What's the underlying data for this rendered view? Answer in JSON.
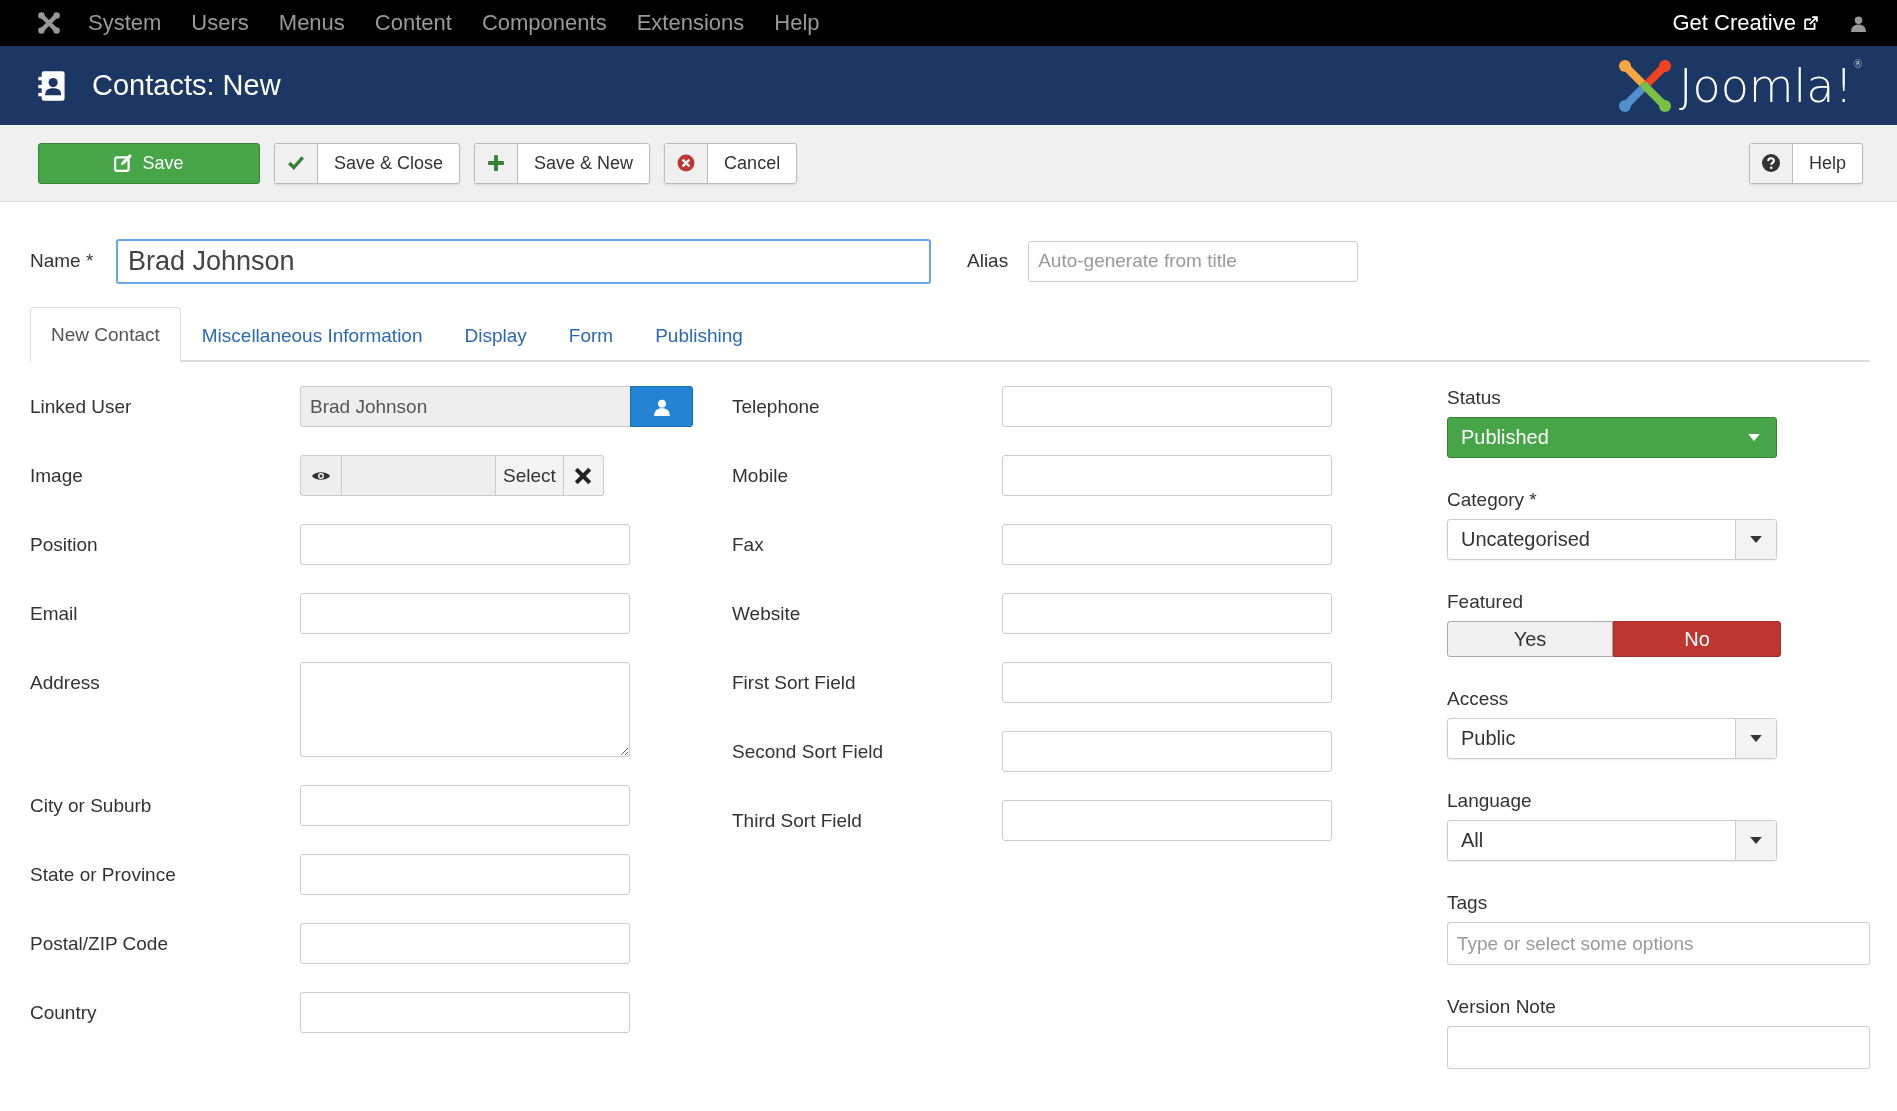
{
  "top_menu": {
    "items": [
      "System",
      "Users",
      "Menus",
      "Content",
      "Components",
      "Extensions",
      "Help"
    ],
    "right_link": "Get Creative"
  },
  "header": {
    "title": "Contacts: New",
    "logo_text": "Joomla!$^{®}$"
  },
  "toolbar": {
    "buttons": [
      {
        "kind": "save",
        "label": "Save"
      },
      {
        "kind": "check",
        "label": "Save & Close"
      },
      {
        "kind": "plus",
        "label": "Save & New"
      },
      {
        "kind": "cancel",
        "label": "Cancel"
      }
    ],
    "help": "Help"
  },
  "name_field": {
    "label": "Name *",
    "value": "Brad Johnson"
  },
  "alias_field": {
    "label": "Alias",
    "placeholder": "Auto-generate from title"
  },
  "tabs": [
    {
      "label": "New Contact",
      "selected": true
    },
    {
      "label": "Miscellaneous Information",
      "selected": false
    },
    {
      "label": "Display",
      "selected": false
    },
    {
      "label": "Form",
      "selected": false
    },
    {
      "label": "Publishing",
      "selected": false
    }
  ],
  "left_fields": [
    {
      "kind": "user",
      "label": "Linked User",
      "value": "Brad Johnson"
    },
    {
      "kind": "media",
      "label": "Image",
      "button": "Select"
    },
    {
      "kind": "text",
      "label": "Position"
    },
    {
      "kind": "text",
      "label": "Email"
    },
    {
      "kind": "textarea",
      "label": "Address"
    },
    {
      "kind": "text",
      "label": "City or Suburb"
    },
    {
      "kind": "text",
      "label": "State or Province"
    },
    {
      "kind": "text",
      "label": "Postal/ZIP Code"
    },
    {
      "kind": "text",
      "label": "Country"
    }
  ],
  "middle_fields": [
    {
      "kind": "text",
      "label": "Telephone"
    },
    {
      "kind": "text",
      "label": "Mobile"
    },
    {
      "kind": "text",
      "label": "Fax"
    },
    {
      "kind": "text",
      "label": "Website"
    },
    {
      "kind": "text",
      "label": "First Sort Field"
    },
    {
      "kind": "text",
      "label": "Second Sort Field"
    },
    {
      "kind": "text",
      "label": "Third Sort Field"
    }
  ],
  "side_fields": [
    {
      "kind": "status",
      "label": "Status",
      "value": "Published"
    },
    {
      "kind": "select",
      "label": "Category *",
      "value": "Uncategorised"
    },
    {
      "kind": "toggle",
      "label": "Featured",
      "options": [
        {
          "label": "Yes",
          "selected": false
        },
        {
          "label": "No",
          "selected": true
        }
      ]
    },
    {
      "kind": "select",
      "label": "Access",
      "value": "Public"
    },
    {
      "kind": "select",
      "label": "Language",
      "value": "All"
    },
    {
      "kind": "tags",
      "label": "Tags",
      "placeholder": "Type or select some options"
    },
    {
      "kind": "text",
      "label": "Version Note"
    }
  ]
}
